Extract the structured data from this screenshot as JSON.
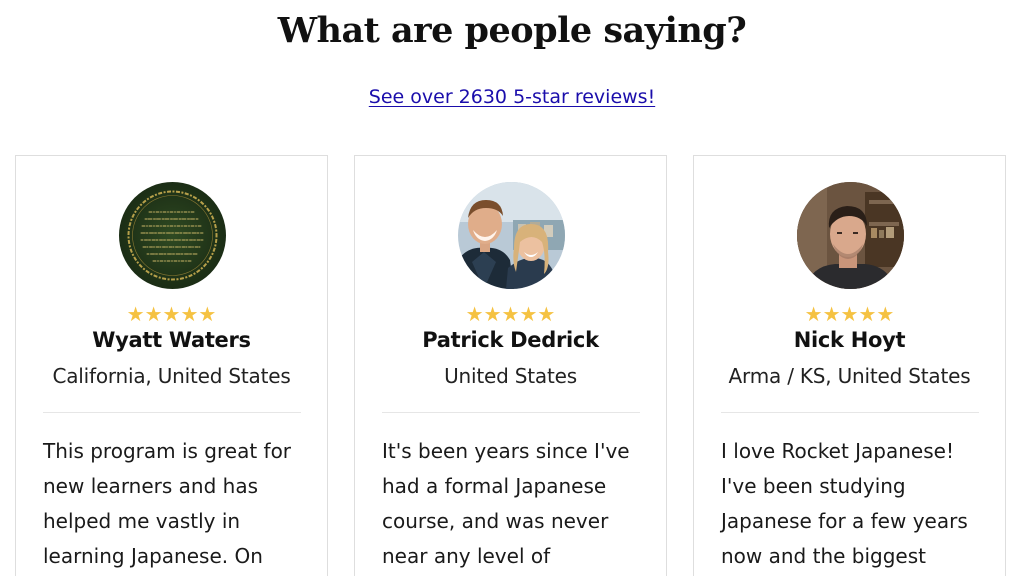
{
  "header": {
    "title": "What are people saying?",
    "reviews_link": "See over 2630 5-star reviews!"
  },
  "colors": {
    "star": "#f5c242",
    "link": "#1a0dab",
    "card_border": "#dedede"
  },
  "testimonials": [
    {
      "avatar_icon": "elvish-ring-inscription-avatar",
      "stars": "★★★★★",
      "rating": 5,
      "name": "Wyatt Waters",
      "location": "California, United States",
      "text_lines": [
        "This program is great for",
        "new learners and has",
        "helped me vastly in",
        "learning Japanese. On"
      ]
    },
    {
      "avatar_icon": "couple-selfie-avatar",
      "stars": "★★★★★",
      "rating": 5,
      "name": "Patrick Dedrick",
      "location": "United States",
      "text_lines": [
        "It's been years since I've",
        "had a formal Japanese",
        "course, and was never",
        "near any level of"
      ]
    },
    {
      "avatar_icon": "man-portrait-avatar",
      "stars": "★★★★★",
      "rating": 5,
      "name": "Nick Hoyt",
      "location": "Arma / KS, United States",
      "text_lines": [
        "I love Rocket Japanese!",
        "I've been studying",
        "Japanese for a few years",
        "now and the biggest"
      ]
    }
  ]
}
